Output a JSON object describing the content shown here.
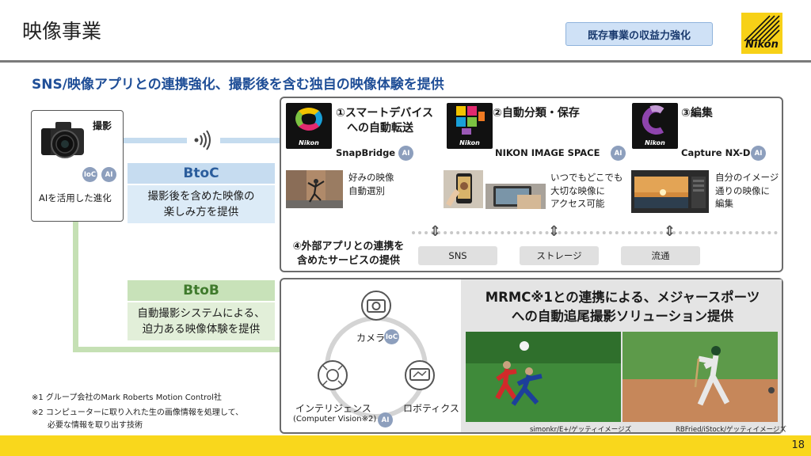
{
  "header": {
    "title": "映像事業",
    "badge": "既存事業の収益力強化",
    "logo_text": "Nikon"
  },
  "subtitle": "SNS/映像アプリとの連携強化、撮影後を含む独自の映像体験を提供",
  "camera": {
    "label": "撮影",
    "desc": "AIを活用した進化",
    "chip_ioc": "IoC",
    "chip_ai": "AI"
  },
  "btoc": {
    "head": "BtoC",
    "body_line1": "撮影後を含めた映像の",
    "body_line2": "楽しみ方を提供"
  },
  "btob": {
    "head": "BtoB",
    "body_line1": "自動撮影システムによる、",
    "body_line2": "迫力ある映像体験を提供"
  },
  "steps": [
    {
      "title_line1": "①スマートデバイス",
      "title_line2": "への自動転送",
      "app": "SnapBridge",
      "desc_line1": "好みの映像",
      "desc_line2": "自動選別",
      "desc_line3": ""
    },
    {
      "title_line1": "②自動分類・保存",
      "title_line2": "",
      "app": "NIKON IMAGE SPACE",
      "desc_line1": "いつでもどこでも",
      "desc_line2": "大切な映像に",
      "desc_line3": "アクセス可能"
    },
    {
      "title_line1": "③編集",
      "title_line2": "",
      "app": "Capture NX-D",
      "desc_line1": "自分のイメージ",
      "desc_line2": "通りの映像に",
      "desc_line3": "編集"
    }
  ],
  "app_brand": "Nikon",
  "ai_chip": "AI",
  "external": {
    "title_line1": "④外部アプリとの連携を",
    "title_line2": "含めたサービスの提供",
    "services": [
      "SNS",
      "ストレージ",
      "流通"
    ]
  },
  "btob_panel": {
    "title_line1": "MRMC※1との連携による、メジャースポーツ",
    "title_line2": "への自動追尾撮影ソリューション提供",
    "camera_label": "カメラ",
    "ioc_chip": "IoC",
    "robotics_label": "ロボティクス",
    "intel_label": "インテリジェンス",
    "intel_sub": "(Computer Vision※2)",
    "credit_left": "simonkr/E+/ゲッティイメージズ",
    "credit_right": "RBFried/iStock/ゲッティイメージズ"
  },
  "notes": {
    "note1": "※1 グループ会社のMark Roberts Motion Control社",
    "note2_line1": "※2 コンピューターに取り入れた生の画像情報を処理して、",
    "note2_line2": "必要な情報を取り出す技術"
  },
  "page_number": "18",
  "colors": {
    "accent_blue": "#1f4e97",
    "btoc_blue": "#c6dcf0",
    "btob_green": "#c8e2b9",
    "footer_yellow": "#f9d71c",
    "chip_gray": "#8d9fbd"
  }
}
